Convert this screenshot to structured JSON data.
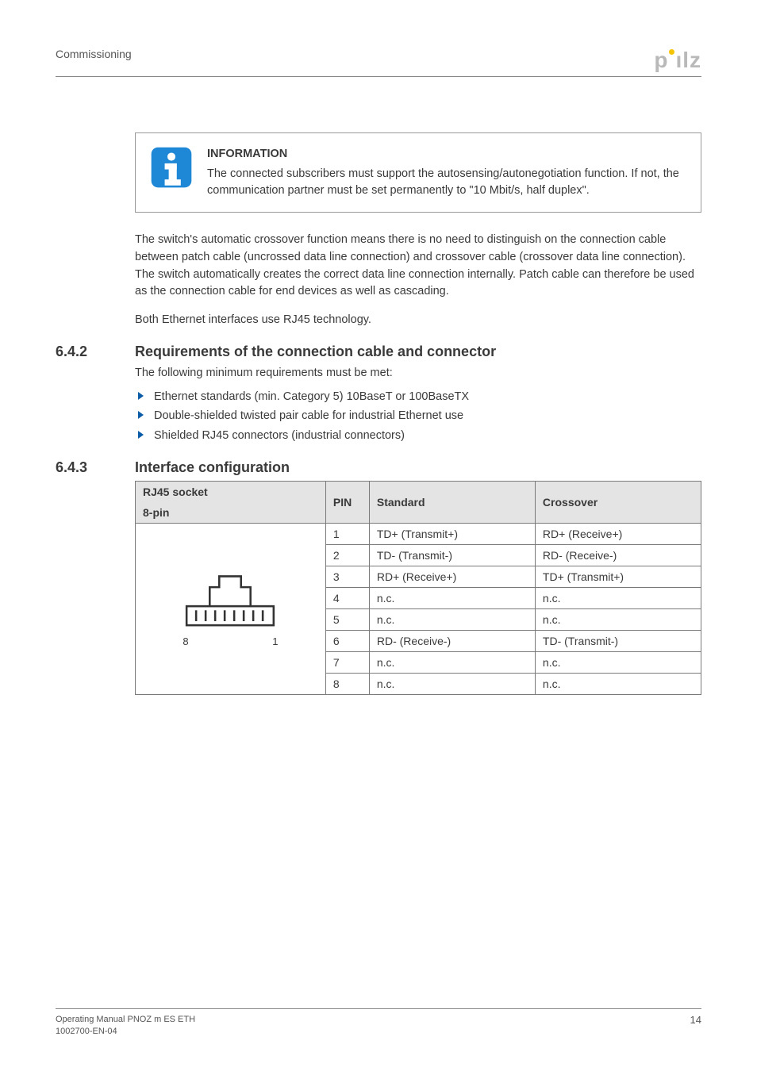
{
  "header": {
    "section": "Commissioning"
  },
  "logo": {
    "text": "pilz"
  },
  "infobox": {
    "title": "INFORMATION",
    "body": "The connected subscribers must support the autosensing/autonegotiation function. If not, the communication partner must be set permanently to \"10 Mbit/s, half duplex\"."
  },
  "para1": "The switch's automatic crossover function means there is no need to distinguish on the connection cable between patch cable (uncrossed data line connection) and crossover cable (crossover data line connection). The switch automatically creates the correct data line connection internally. Patch cable can therefore be used as the connection cable for end devices as well as cascading.",
  "para2": "Both Ethernet interfaces use RJ45 technology.",
  "section642": {
    "num": "6.4.2",
    "title": "Requirements of the connection cable and connector",
    "intro": "The following minimum requirements must be met:",
    "bullets": [
      "Ethernet standards (min. Category 5) 10BaseT or 100BaseTX",
      "Double-shielded twisted pair cable for industrial Ethernet use",
      "Shielded RJ45 connectors (industrial connectors)"
    ]
  },
  "section643": {
    "num": "6.4.3",
    "title": "Interface configuration"
  },
  "table": {
    "headers": {
      "socket": "RJ45 socket",
      "pins": "8-pin",
      "pin": "PIN",
      "standard": "Standard",
      "crossover": "Crossover"
    },
    "socket_labels": {
      "left": "8",
      "right": "1"
    },
    "rows": [
      {
        "pin": "1",
        "standard": "TD+ (Transmit+)",
        "crossover": "RD+ (Receive+)"
      },
      {
        "pin": "2",
        "standard": "TD- (Transmit-)",
        "crossover": "RD- (Receive-)"
      },
      {
        "pin": "3",
        "standard": "RD+ (Receive+)",
        "crossover": "TD+ (Transmit+)"
      },
      {
        "pin": "4",
        "standard": "n.c.",
        "crossover": "n.c."
      },
      {
        "pin": "5",
        "standard": "n.c.",
        "crossover": "n.c."
      },
      {
        "pin": "6",
        "standard": "RD- (Receive-)",
        "crossover": "TD- (Transmit-)"
      },
      {
        "pin": "7",
        "standard": "n.c.",
        "crossover": "n.c."
      },
      {
        "pin": "8",
        "standard": "n.c.",
        "crossover": "n.c."
      }
    ]
  },
  "footer": {
    "line1": "Operating Manual PNOZ m ES ETH",
    "line2": "1002700-EN-04",
    "page": "14"
  }
}
